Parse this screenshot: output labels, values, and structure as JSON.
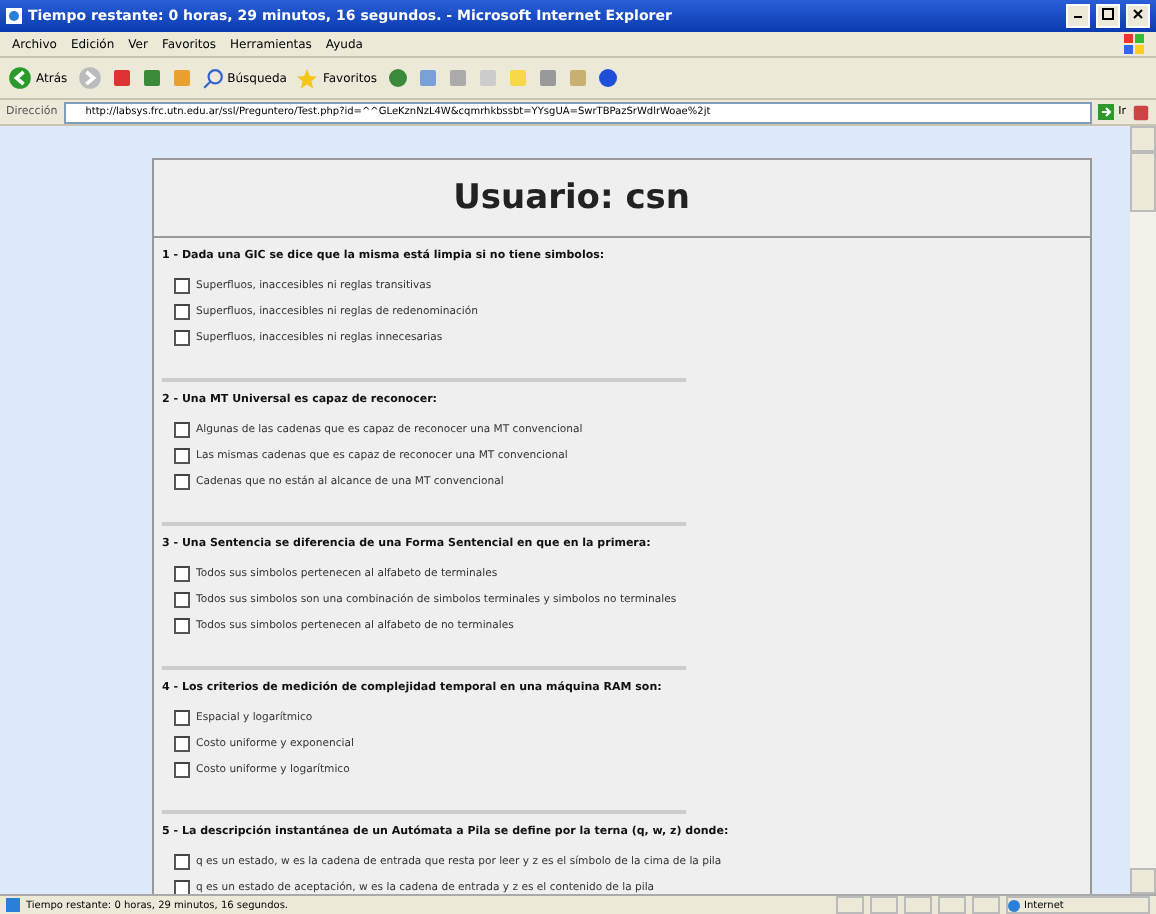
{
  "window": {
    "title": "Tiempo restante: 0 horas, 29 minutos, 16 segundos. - Microsoft Internet Explorer"
  },
  "menu": [
    "Archivo",
    "Edición",
    "Ver",
    "Favoritos",
    "Herramientas",
    "Ayuda"
  ],
  "toolbar": {
    "back": "Atrás",
    "search": "Búsqueda",
    "favorites": "Favoritos"
  },
  "address": {
    "label": "Dirección",
    "value": "http://labsys.frc.utn.edu.ar/ssl/Preguntero/Test.php?id=^^GLeKznNzL4W&cqmrhkbssbt=YYsgUA=SwrTBPazSrWdlrWoae%2jt",
    "go": "Ir"
  },
  "page": {
    "heading": "Usuario: csn",
    "questions": [
      {
        "title": "1 - Dada una GIC se dice que la misma está limpia si no tiene simbolos:",
        "options": [
          {
            "label": "Superfluos, inaccesibles ni reglas transitivas",
            "checked": false
          },
          {
            "label": "Superfluos, inaccesibles ni reglas de redenominación",
            "checked": false
          },
          {
            "label": "Superfluos, inaccesibles ni reglas innecesarias",
            "checked": false
          }
        ]
      },
      {
        "title": "2 - Una MT Universal es capaz de reconocer:",
        "options": [
          {
            "label": "Algunas de las cadenas que es capaz de reconocer una MT convencional",
            "checked": false
          },
          {
            "label": "Las mismas cadenas que es capaz de reconocer una MT convencional",
            "checked": false
          },
          {
            "label": "Cadenas que no están al alcance de una MT convencional",
            "checked": false
          }
        ]
      },
      {
        "title": "3 - Una Sentencia se diferencia de una Forma Sentencial en que en la primera:",
        "options": [
          {
            "label": "Todos sus simbolos pertenecen al alfabeto de terminales",
            "checked": false
          },
          {
            "label": "Todos sus simbolos son una combinación de simbolos terminales y simbolos no terminales",
            "checked": false
          },
          {
            "label": "Todos sus simbolos pertenecen al alfabeto de no terminales",
            "checked": false
          }
        ]
      },
      {
        "title": "4 - Los criterios de medición de complejidad temporal en una máquina RAM son:",
        "options": [
          {
            "label": "Espacial y logarítmico",
            "checked": false
          },
          {
            "label": "Costo uniforme y exponencial",
            "checked": false
          },
          {
            "label": "Costo uniforme y logarítmico",
            "checked": false
          }
        ]
      },
      {
        "title": "5 - La descripción instantánea de un Autómata a Pila se define por la terna (q, w, z) donde:",
        "options": [
          {
            "label": "q es un estado, w es la cadena de entrada que resta por leer y z es el símbolo de la cima de la pila",
            "checked": false
          },
          {
            "label": "q es un estado de aceptación, w es la cadena de entrada y z es el contenido de la pila",
            "checked": false
          }
        ]
      }
    ]
  },
  "status_bar": {
    "text": "Tiempo restante: 0 horas, 29 minutos, 16 segundos.",
    "zone": "Internet"
  }
}
